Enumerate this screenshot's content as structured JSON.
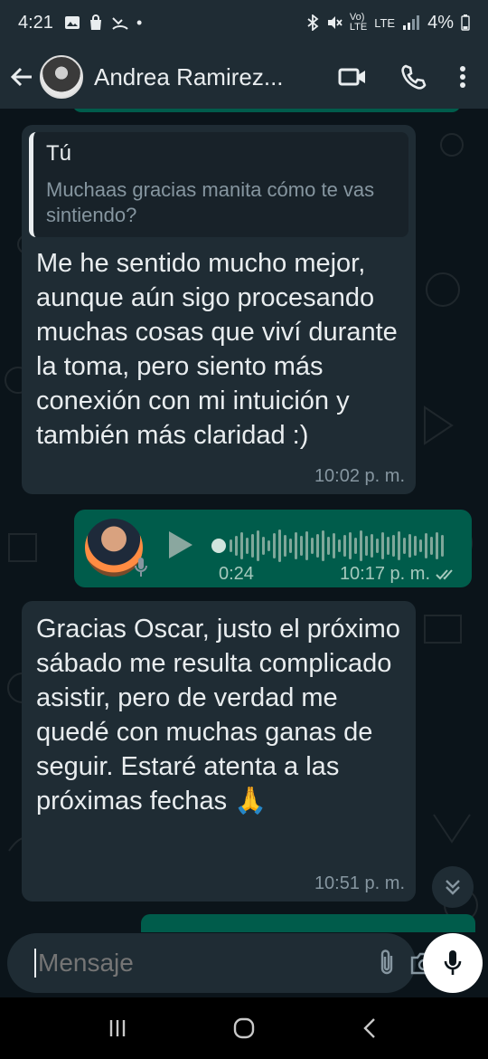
{
  "status_bar": {
    "time": "4:21",
    "battery": "4%",
    "network": "LTE"
  },
  "header": {
    "contact_name": "Andrea Ramirez..."
  },
  "messages": [
    {
      "quote": {
        "author": "Tú",
        "text": "Muchaas gracias manita cómo te vas sintiendo?"
      },
      "text": "Me he sentido mucho mejor, aunque aún sigo procesando muchas cosas que viví durante la toma, pero siento más conexión con mi intuición y también más claridad :)",
      "time": "10:02 p. m."
    },
    {
      "voice_note": {
        "duration": "0:24",
        "time": "10:17 p. m.",
        "status_icon": "double-check-icon"
      }
    },
    {
      "text": "Gracias Oscar, justo el próximo sábado me resulta complicado asistir, pero de verdad me quedé con muchas ganas de seguir. Estaré atenta a las próximas fechas 🙏",
      "time": "10:51 p. m."
    }
  ],
  "composer": {
    "placeholder": "Mensaje"
  },
  "colors": {
    "incoming_bubble": "#1f2c34",
    "outgoing_bubble": "#005c4b",
    "background": "#0b141a"
  }
}
